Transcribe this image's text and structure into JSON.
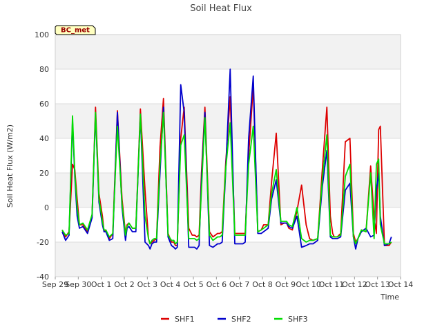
{
  "chart_data": {
    "type": "line",
    "title": "Soil Heat Flux",
    "xlabel": "Time",
    "ylabel": "Soil Heat Flux (W/m2)",
    "site_badge": "BC_met",
    "ylim": [
      -40,
      100
    ],
    "xlim": [
      0,
      15
    ],
    "y_ticks": [
      -40,
      -20,
      0,
      20,
      40,
      60,
      80,
      100
    ],
    "x_ticks": [
      {
        "x": 0,
        "label": "Sep 29"
      },
      {
        "x": 1,
        "label": "Sep 30"
      },
      {
        "x": 2,
        "label": "Oct 1"
      },
      {
        "x": 3,
        "label": "Oct 2"
      },
      {
        "x": 4,
        "label": "Oct 3"
      },
      {
        "x": 5,
        "label": "Oct 4"
      },
      {
        "x": 6,
        "label": "Oct 5"
      },
      {
        "x": 7,
        "label": "Oct 6"
      },
      {
        "x": 8,
        "label": "Oct 7"
      },
      {
        "x": 9,
        "label": "Oct 8"
      },
      {
        "x": 10,
        "label": "Oct 9"
      },
      {
        "x": 11,
        "label": "Oct 10"
      },
      {
        "x": 12,
        "label": "Oct 11"
      },
      {
        "x": 13,
        "label": "Oct 12"
      },
      {
        "x": 14,
        "label": "Oct 13"
      },
      {
        "x": 15,
        "label": "Oct 14"
      }
    ],
    "grid": true,
    "legend_position": "bottom-center",
    "series": [
      {
        "name": "SHF1",
        "color": "#dd0000",
        "x": [
          0.3,
          0.45,
          0.6,
          0.75,
          0.85,
          0.95,
          1.05,
          1.2,
          1.4,
          1.6,
          1.75,
          1.9,
          2.05,
          2.12,
          2.2,
          2.35,
          2.5,
          2.7,
          2.9,
          3.05,
          3.12,
          3.2,
          3.35,
          3.5,
          3.7,
          3.9,
          4.05,
          4.12,
          4.2,
          4.3,
          4.4,
          4.55,
          4.7,
          4.9,
          5.05,
          5.15,
          5.22,
          5.3,
          5.45,
          5.6,
          5.8,
          5.95,
          6.05,
          6.15,
          6.25,
          6.35,
          6.5,
          6.7,
          6.85,
          6.95,
          7.05,
          7.15,
          7.25,
          7.4,
          7.6,
          7.8,
          7.95,
          8.05,
          8.15,
          8.25,
          8.4,
          8.6,
          8.8,
          8.95,
          9.05,
          9.15,
          9.25,
          9.4,
          9.6,
          9.8,
          9.95,
          10.05,
          10.15,
          10.3,
          10.5,
          10.7,
          10.9,
          11.05,
          11.2,
          11.4,
          11.6,
          11.8,
          11.95,
          12.05,
          12.12,
          12.25,
          12.4,
          12.6,
          12.8,
          12.95,
          13.05,
          13.15,
          13.3,
          13.5,
          13.7,
          13.85,
          13.95,
          14.05,
          14.12,
          14.3,
          14.5,
          14.6
        ],
        "y": [
          -13,
          -17,
          -14,
          25,
          22,
          5,
          -10,
          -10,
          -14,
          -5,
          58,
          8,
          -5,
          -14,
          -13,
          -18,
          -15,
          56,
          5,
          -15,
          -10,
          -9,
          -12,
          -12,
          57,
          10,
          -18,
          -21,
          -20,
          -19,
          -18,
          35,
          63,
          -15,
          -20,
          -20,
          -22,
          -22,
          40,
          58,
          -12,
          -16,
          -16,
          -17,
          -16,
          20,
          58,
          -14,
          -17,
          -16,
          -15,
          -15,
          -14,
          25,
          64,
          -15,
          -15,
          -15,
          -15,
          -15,
          30,
          70,
          -14,
          -13,
          -10,
          -10,
          -10,
          15,
          43,
          -10,
          -9,
          -9,
          -12,
          -13,
          -2,
          13,
          -10,
          -18,
          -19,
          -18,
          22,
          58,
          -5,
          -15,
          -17,
          -17,
          -15,
          38,
          40,
          -15,
          -20,
          -18,
          -13,
          -14,
          24,
          -6,
          -15,
          45,
          47,
          -22,
          -22,
          -20
        ],
        "values": [
          -13,
          -17,
          -14,
          25,
          22,
          5,
          -10,
          -10,
          -14,
          -5,
          58,
          8,
          -5,
          -14,
          -13,
          -18,
          -15,
          56,
          5,
          -15,
          -10,
          -9,
          -12,
          -12,
          57,
          10,
          -18,
          -21,
          -20,
          -19,
          -18,
          35,
          63,
          -15,
          -20,
          -20,
          -22,
          -22,
          40,
          58,
          -12,
          -16,
          -16,
          -17,
          -16,
          20,
          58,
          -14,
          -17,
          -16,
          -15,
          -15,
          -14,
          25,
          64,
          -15,
          -15,
          -15,
          -15,
          -15,
          30,
          70,
          -14,
          -13,
          -10,
          -10,
          -10,
          15,
          43,
          -10,
          -9,
          -9,
          -12,
          -13,
          -2,
          13,
          -10,
          -18,
          -19,
          -18,
          22,
          58,
          -5,
          -15,
          -17,
          -17,
          -15,
          38,
          40,
          -15,
          -20,
          -18,
          -13,
          -14,
          24,
          -6,
          -15,
          45,
          47,
          -22,
          -22,
          -20
        ]
      },
      {
        "name": "SHF2",
        "color": "#0000cc",
        "x": [
          0.3,
          0.45,
          0.6,
          0.75,
          0.85,
          0.95,
          1.05,
          1.2,
          1.4,
          1.6,
          1.75,
          1.9,
          2.05,
          2.12,
          2.2,
          2.35,
          2.5,
          2.7,
          2.9,
          3.05,
          3.12,
          3.2,
          3.35,
          3.5,
          3.7,
          3.9,
          4.05,
          4.12,
          4.2,
          4.3,
          4.4,
          4.55,
          4.7,
          4.9,
          5.05,
          5.15,
          5.22,
          5.3,
          5.45,
          5.6,
          5.8,
          5.95,
          6.05,
          6.15,
          6.25,
          6.35,
          6.5,
          6.7,
          6.85,
          6.95,
          7.05,
          7.15,
          7.25,
          7.4,
          7.6,
          7.8,
          7.95,
          8.05,
          8.15,
          8.25,
          8.4,
          8.6,
          8.8,
          8.95,
          9.05,
          9.15,
          9.25,
          9.4,
          9.6,
          9.8,
          9.95,
          10.05,
          10.15,
          10.3,
          10.5,
          10.7,
          10.9,
          11.05,
          11.2,
          11.4,
          11.6,
          11.8,
          11.95,
          12.05,
          12.12,
          12.25,
          12.4,
          12.6,
          12.8,
          12.95,
          13.05,
          13.15,
          13.3,
          13.5,
          13.7,
          13.85,
          13.95,
          14.05,
          14.12,
          14.3,
          14.5,
          14.6
        ],
        "y": [
          -14,
          -19,
          -16,
          50,
          18,
          -5,
          -12,
          -11,
          -15,
          -6,
          54,
          3,
          -10,
          -14,
          -14,
          -19,
          -18,
          55,
          0,
          -19,
          -12,
          -11,
          -14,
          -14,
          54,
          -20,
          -22,
          -24,
          -21,
          -20,
          -20,
          20,
          58,
          -17,
          -22,
          -23,
          -24,
          -23,
          71,
          55,
          -23,
          -23,
          -23,
          -24,
          -22,
          15,
          55,
          -22,
          -23,
          -22,
          -21,
          -21,
          -20,
          20,
          80,
          -21,
          -21,
          -21,
          -21,
          -20,
          40,
          76,
          -15,
          -15,
          -14,
          -13,
          -12,
          5,
          16,
          -9,
          -9,
          -9,
          -11,
          -12,
          -5,
          -23,
          -22,
          -21,
          -21,
          -19,
          12,
          33,
          -17,
          -18,
          -18,
          -18,
          -17,
          10,
          14,
          -17,
          -24,
          -18,
          -14,
          -12,
          -17,
          -16,
          10,
          20,
          -5,
          -22,
          -21,
          -17
        ],
        "values": [
          -14,
          -19,
          -16,
          50,
          18,
          -5,
          -12,
          -11,
          -15,
          -6,
          54,
          3,
          -10,
          -14,
          -14,
          -19,
          -18,
          55,
          0,
          -19,
          -12,
          -11,
          -14,
          -14,
          54,
          -20,
          -22,
          -24,
          -21,
          -20,
          -20,
          20,
          58,
          -17,
          -22,
          -23,
          -24,
          -23,
          71,
          55,
          -23,
          -23,
          -23,
          -24,
          -22,
          15,
          55,
          -22,
          -23,
          -22,
          -21,
          -21,
          -20,
          20,
          80,
          -21,
          -21,
          -21,
          -21,
          -20,
          40,
          76,
          -15,
          -15,
          -14,
          -13,
          -12,
          5,
          16,
          -9,
          -9,
          -9,
          -11,
          -12,
          -5,
          -23,
          -22,
          -21,
          -21,
          -19,
          12,
          33,
          -17,
          -18,
          -18,
          -18,
          -17,
          10,
          14,
          -17,
          -24,
          -18,
          -14,
          -12,
          -17,
          -16,
          10,
          20,
          -5,
          -22,
          -21,
          -17
        ]
      },
      {
        "name": "SHF3",
        "color": "#00dd00",
        "x": [
          0.3,
          0.45,
          0.6,
          0.75,
          0.85,
          0.95,
          1.05,
          1.2,
          1.4,
          1.6,
          1.75,
          1.9,
          2.05,
          2.12,
          2.2,
          2.35,
          2.5,
          2.7,
          2.9,
          3.05,
          3.12,
          3.2,
          3.35,
          3.5,
          3.7,
          3.9,
          4.05,
          4.12,
          4.2,
          4.3,
          4.4,
          4.55,
          4.7,
          4.9,
          5.05,
          5.15,
          5.22,
          5.3,
          5.45,
          5.6,
          5.8,
          5.95,
          6.05,
          6.15,
          6.25,
          6.35,
          6.5,
          6.7,
          6.85,
          6.95,
          7.05,
          7.15,
          7.25,
          7.4,
          7.6,
          7.8,
          7.95,
          8.05,
          8.15,
          8.25,
          8.4,
          8.6,
          8.8,
          8.95,
          9.05,
          9.15,
          9.25,
          9.4,
          9.6,
          9.8,
          9.95,
          10.05,
          10.15,
          10.3,
          10.5,
          10.7,
          10.9,
          11.05,
          11.2,
          11.4,
          11.6,
          11.8,
          11.95,
          12.05,
          12.12,
          12.25,
          12.4,
          12.6,
          12.8,
          12.95,
          13.05,
          13.15,
          13.3,
          13.5,
          13.7,
          13.85,
          13.95,
          14.05,
          14.12,
          14.3,
          14.5,
          14.6
        ],
        "y": [
          -13,
          -16,
          -15,
          53,
          20,
          0,
          -10,
          -9,
          -13,
          -4,
          55,
          5,
          -8,
          -13,
          -13,
          -17,
          -15,
          47,
          2,
          -16,
          -11,
          -9,
          -12,
          -12,
          54,
          -5,
          -18,
          -21,
          -19,
          -18,
          -18,
          25,
          55,
          -16,
          -19,
          -19,
          -21,
          -20,
          36,
          42,
          -18,
          -18,
          -18,
          -19,
          -18,
          10,
          52,
          -16,
          -19,
          -18,
          -17,
          -17,
          -16,
          22,
          49,
          -16,
          -16,
          -16,
          -16,
          -16,
          25,
          47,
          -14,
          -13,
          -12,
          -11,
          -10,
          8,
          22,
          -8,
          -8,
          -8,
          -10,
          -11,
          0,
          -18,
          -20,
          -19,
          -19,
          -18,
          16,
          42,
          -16,
          -17,
          -17,
          -17,
          -16,
          18,
          25,
          -17,
          -21,
          -18,
          -13,
          -14,
          20,
          -18,
          25,
          28,
          -10,
          -21,
          -21,
          -20
        ],
        "values": [
          -13,
          -16,
          -15,
          53,
          20,
          0,
          -10,
          -9,
          -13,
          -4,
          55,
          5,
          -8,
          -13,
          -13,
          -17,
          -15,
          47,
          2,
          -16,
          -11,
          -9,
          -12,
          -12,
          54,
          -5,
          -18,
          -21,
          -19,
          -18,
          -18,
          25,
          55,
          -16,
          -19,
          -19,
          -21,
          -20,
          36,
          42,
          -18,
          -18,
          -18,
          -19,
          -18,
          10,
          52,
          -16,
          -19,
          -18,
          -17,
          -17,
          -16,
          22,
          49,
          -16,
          -16,
          -16,
          -16,
          -16,
          25,
          47,
          -14,
          -13,
          -12,
          -11,
          -10,
          8,
          22,
          -8,
          -8,
          -8,
          -10,
          -11,
          0,
          -18,
          -20,
          -19,
          -19,
          -18,
          16,
          42,
          -16,
          -17,
          -17,
          -17,
          -16,
          18,
          25,
          -17,
          -21,
          -18,
          -13,
          -14,
          20,
          -18,
          25,
          28,
          -10,
          -21,
          -21,
          -20
        ]
      }
    ]
  }
}
